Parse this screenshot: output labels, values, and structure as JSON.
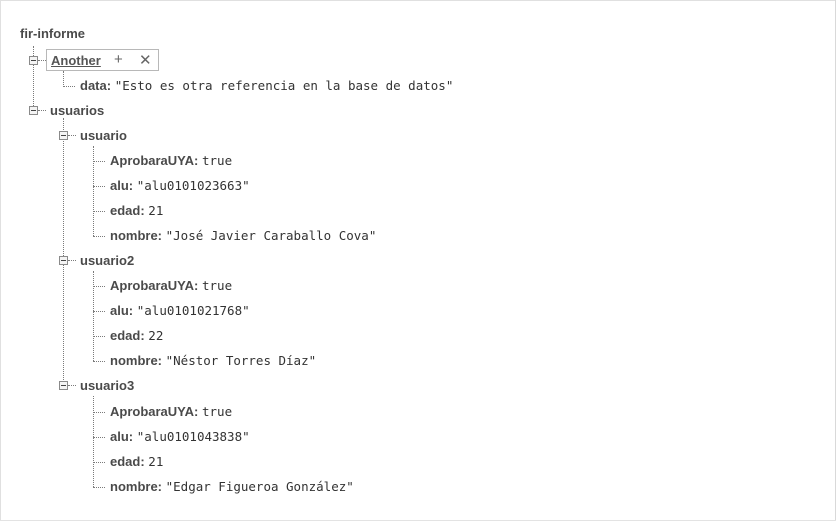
{
  "root": {
    "title": "fir-informe"
  },
  "another": {
    "key": "Another",
    "add_icon": "plus-icon",
    "remove_icon": "close-icon",
    "data_key": "data:",
    "data_value": "\"Esto es otra referencia en la base de datos\""
  },
  "usuarios": {
    "key": "usuarios",
    "users": [
      {
        "key": "usuario",
        "fields": [
          {
            "k": "AprobaraUYA:",
            "v": "true"
          },
          {
            "k": "alu:",
            "v": "\"alu0101023663\""
          },
          {
            "k": "edad:",
            "v": "21"
          },
          {
            "k": "nombre:",
            "v": "\"José Javier Caraballo Cova\""
          }
        ]
      },
      {
        "key": "usuario2",
        "fields": [
          {
            "k": "AprobaraUYA:",
            "v": "true"
          },
          {
            "k": "alu:",
            "v": "\"alu0101021768\""
          },
          {
            "k": "edad:",
            "v": "22"
          },
          {
            "k": "nombre:",
            "v": "\"Néstor Torres Díaz\""
          }
        ]
      },
      {
        "key": "usuario3",
        "fields": [
          {
            "k": "AprobaraUYA:",
            "v": "true"
          },
          {
            "k": "alu:",
            "v": "\"alu0101043838\""
          },
          {
            "k": "edad:",
            "v": "21"
          },
          {
            "k": "nombre:",
            "v": "\"Edgar Figueroa González\""
          }
        ]
      }
    ]
  }
}
